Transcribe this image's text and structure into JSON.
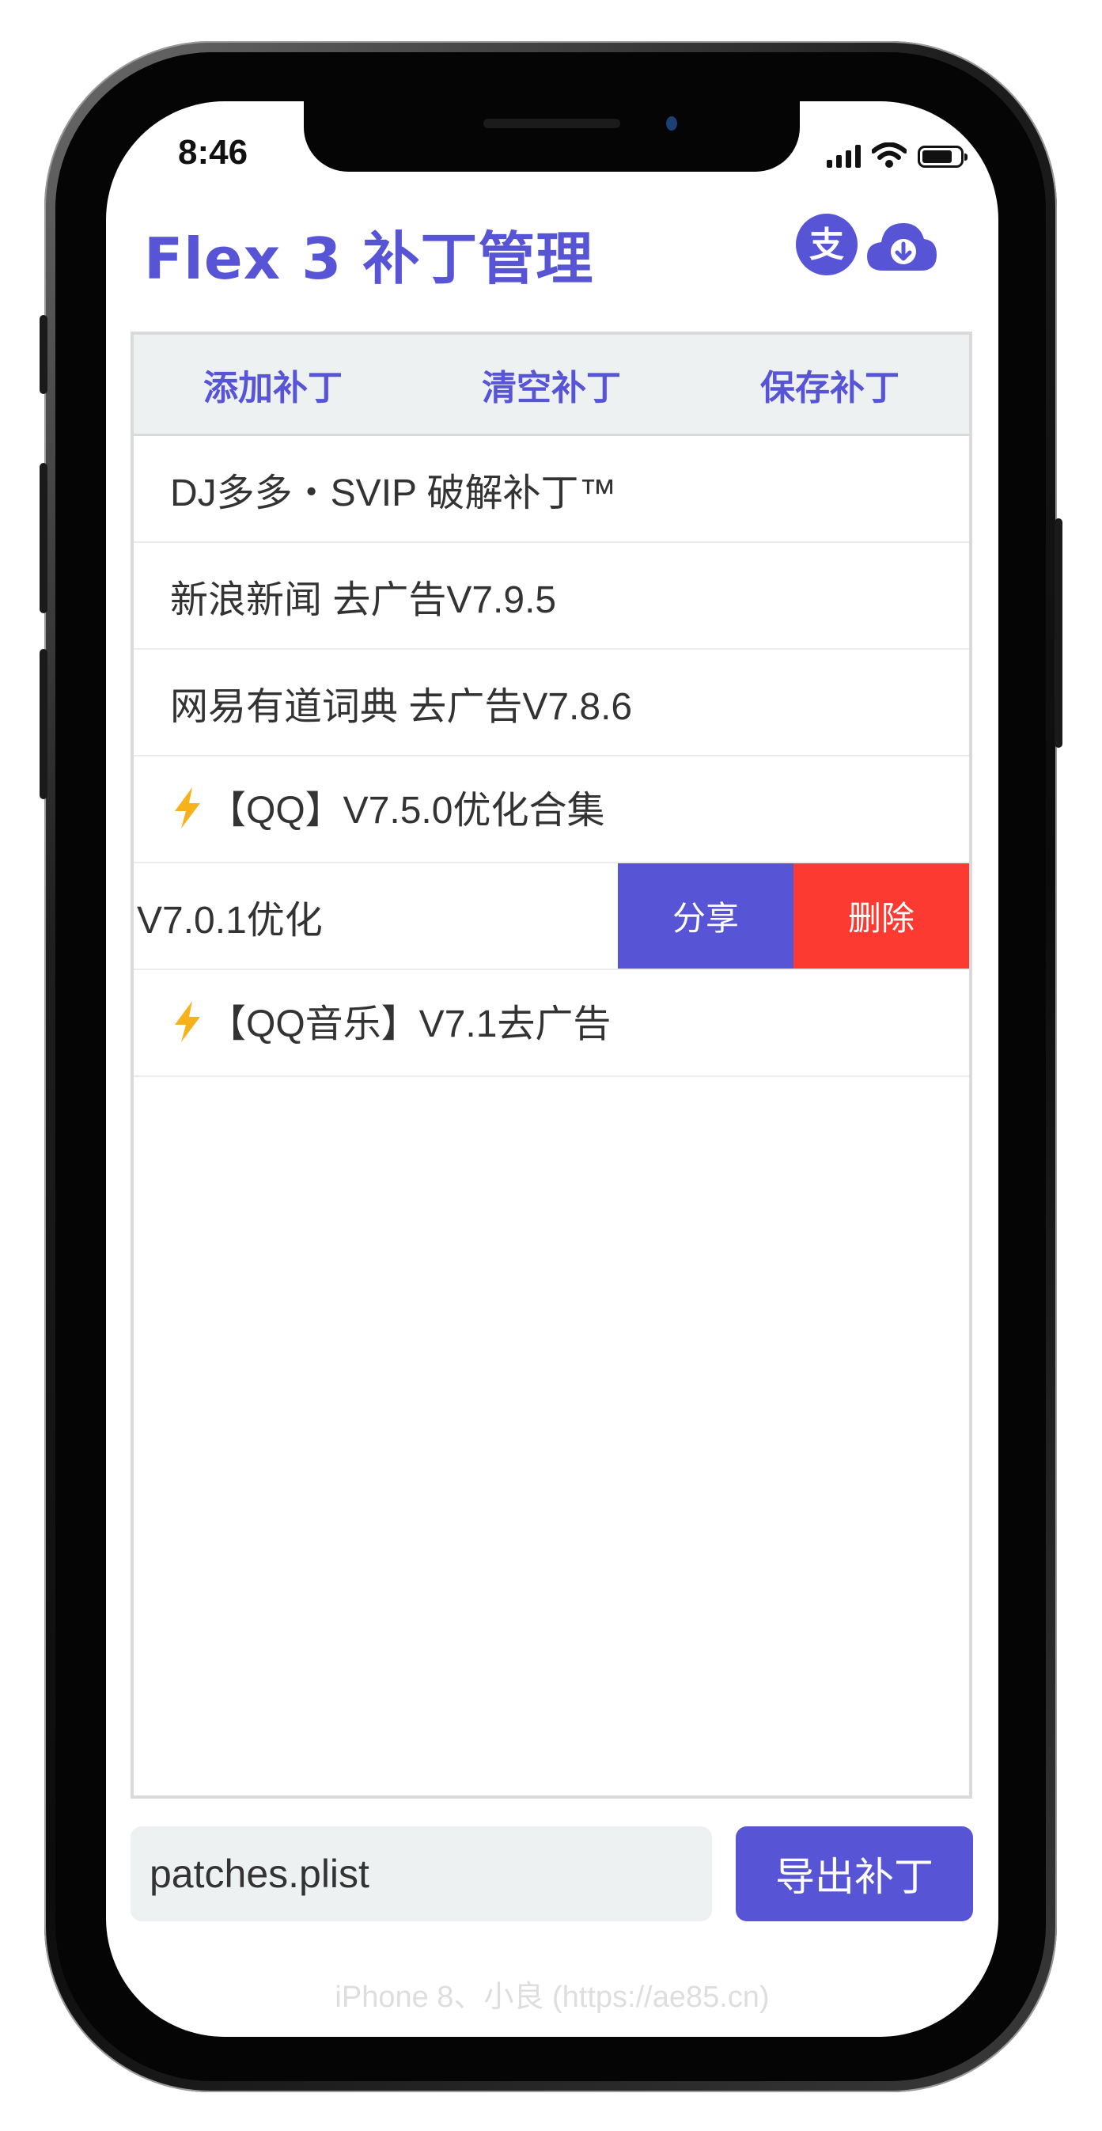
{
  "status_bar": {
    "time": "8:46"
  },
  "header": {
    "title": "Flex 3 补丁管理",
    "alipay_icon": "alipay-icon",
    "download_icon": "cloud-download-icon"
  },
  "toolbar": {
    "add_label": "添加补丁",
    "clear_label": "清空补丁",
    "save_label": "保存补丁"
  },
  "patches": [
    {
      "label": "DJ多多・SVIP 破解补丁™"
    },
    {
      "label": "新浪新闻 去广告V7.9.5"
    },
    {
      "label": "网易有道词典 去广告V7.8.6"
    },
    {
      "label": "【QQ】V7.5.0优化合集",
      "icon": "lightning-icon"
    },
    {
      "label": "V7.0.1优化",
      "swiped": true,
      "share_label": "分享",
      "delete_label": "删除"
    },
    {
      "label": "【QQ音乐】V7.1去广告",
      "icon": "lightning-icon"
    }
  ],
  "export": {
    "filename": "patches.plist",
    "button_label": "导出补丁"
  },
  "footer": {
    "credit": "iPhone 8、小良 (https://ae85.cn)"
  },
  "colors": {
    "accent": "#5755d6",
    "delete": "#fc3a31",
    "toolbar_bg": "#eef1f1",
    "bolt": "#f5b21a"
  }
}
